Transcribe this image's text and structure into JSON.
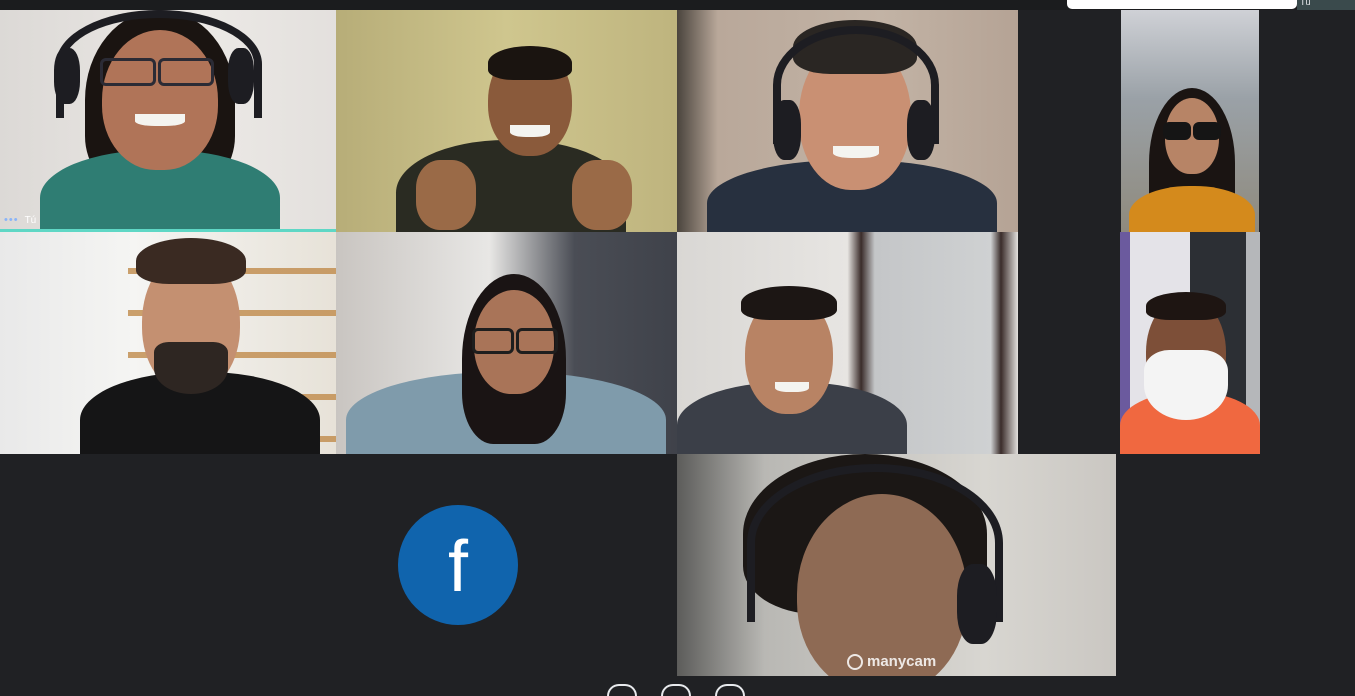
{
  "self_view": {
    "label": "Tú"
  },
  "participants": [
    {
      "label": "Tú",
      "speaking": true
    },
    {
      "label": ""
    },
    {
      "label": ""
    },
    {
      "label": ""
    },
    {
      "label": ""
    },
    {
      "label": ""
    },
    {
      "label": ""
    },
    {
      "label": ""
    },
    {
      "label": ""
    },
    {
      "label": ""
    }
  ],
  "presenter_tile": {
    "logo_letter": "f",
    "logo_color": "#1064ad"
  },
  "watermark": {
    "text": "manycam"
  },
  "colors": {
    "background": "#202124",
    "active_speaker": "#5fd7c5"
  },
  "icons": {
    "more_options": "more-options-icon"
  }
}
